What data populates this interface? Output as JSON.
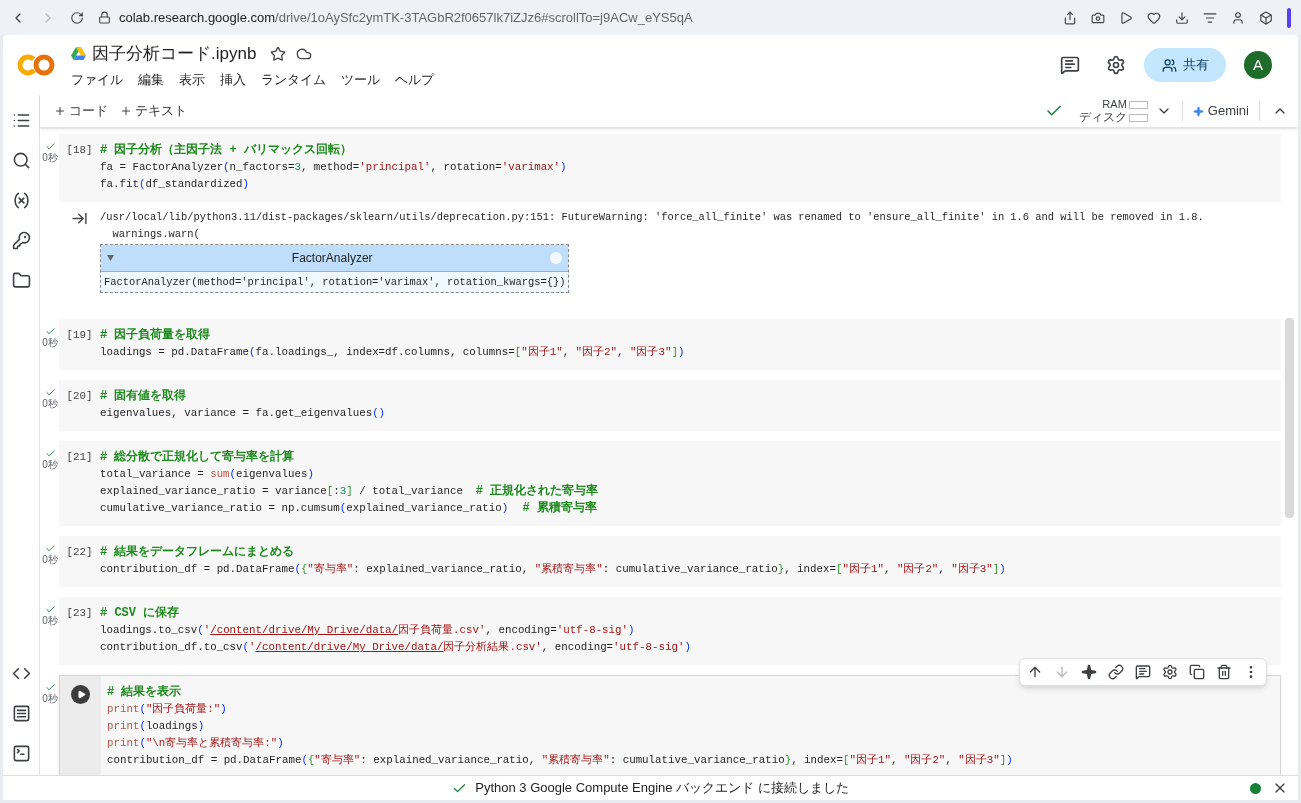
{
  "browser": {
    "url_host": "colab.research.google.com",
    "url_path": "/drive/1oAySfc2ymTK-3TAGbR2f0657lk7iZJz6#scrollTo=j9ACw_eYS5qA"
  },
  "header": {
    "title": "因子分析コード.ipynb",
    "menu": [
      "ファイル",
      "編集",
      "表示",
      "挿入",
      "ランタイム",
      "ツール",
      "ヘルプ"
    ],
    "share": "共有",
    "avatar": "A"
  },
  "toolbar": {
    "add_code": "コード",
    "add_text": "テキスト",
    "connected": true,
    "ram": "RAM",
    "disk": "ディスク",
    "gemini": "Gemini"
  },
  "cells": [
    {
      "count": "[18]",
      "status": "0秒",
      "executed": true,
      "selected": false,
      "lines": [
        [
          {
            "kind": "comment",
            "text": "# 因子分析（主因子法 + バリマックス回転）"
          }
        ],
        [
          {
            "kind": "text",
            "text": "fa = FactorAnalyzer"
          },
          {
            "kind": "paren",
            "text": "("
          },
          {
            "kind": "text",
            "text": "n_factors="
          },
          {
            "kind": "number",
            "text": "3"
          },
          {
            "kind": "text",
            "text": ", method="
          },
          {
            "kind": "string",
            "text": "'principal'"
          },
          {
            "kind": "text",
            "text": ", rotation="
          },
          {
            "kind": "string",
            "text": "'varimax'"
          },
          {
            "kind": "paren",
            "text": ")"
          }
        ],
        [
          {
            "kind": "text",
            "text": "fa.fit"
          },
          {
            "kind": "paren",
            "text": "("
          },
          {
            "kind": "text",
            "text": "df_standardized"
          },
          {
            "kind": "paren",
            "text": ")"
          }
        ]
      ],
      "output": {
        "lines": [
          "/usr/local/lib/python3.11/dist-packages/sklearn/utils/deprecation.py:151: FutureWarning: 'force_all_finite' was renamed to 'ensure_all_finite' in 1.6 and will be removed in 1.8.",
          "  warnings.warn("
        ],
        "widget": {
          "title": "FactorAnalyzer",
          "expanded": true,
          "body": "FactorAnalyzer(method='principal', rotation='varimax', rotation_kwargs={})"
        }
      }
    },
    {
      "count": "[19]",
      "status": "0秒",
      "executed": true,
      "selected": false,
      "lines": [
        [
          {
            "kind": "comment",
            "text": "# 因子負荷量を取得"
          }
        ],
        [
          {
            "kind": "text",
            "text": "loadings = pd.DataFrame"
          },
          {
            "kind": "paren",
            "text": "("
          },
          {
            "kind": "text",
            "text": "fa.loadings_, index=df.columns, columns="
          },
          {
            "kind": "bracket",
            "text": "["
          },
          {
            "kind": "string",
            "text": "\"因子1\""
          },
          {
            "kind": "text",
            "text": ", "
          },
          {
            "kind": "string",
            "text": "\"因子2\""
          },
          {
            "kind": "text",
            "text": ", "
          },
          {
            "kind": "string",
            "text": "\"因子3\""
          },
          {
            "kind": "bracket",
            "text": "]"
          },
          {
            "kind": "paren",
            "text": ")"
          }
        ]
      ]
    },
    {
      "count": "[20]",
      "status": "0秒",
      "executed": true,
      "selected": false,
      "lines": [
        [
          {
            "kind": "comment",
            "text": "# 固有値を取得"
          }
        ],
        [
          {
            "kind": "text",
            "text": "eigenvalues, variance = fa.get_eigenvalues"
          },
          {
            "kind": "paren",
            "text": "()"
          }
        ]
      ]
    },
    {
      "count": "[21]",
      "status": "0秒",
      "executed": true,
      "selected": false,
      "lines": [
        [
          {
            "kind": "comment",
            "text": "# 総分散で正規化して寄与率を計算"
          }
        ],
        [
          {
            "kind": "text",
            "text": "total_variance = "
          },
          {
            "kind": "builtin",
            "text": "sum"
          },
          {
            "kind": "paren",
            "text": "("
          },
          {
            "kind": "text",
            "text": "eigenvalues"
          },
          {
            "kind": "paren",
            "text": ")"
          }
        ],
        [
          {
            "kind": "text",
            "text": "explained_variance_ratio = variance"
          },
          {
            "kind": "bracket",
            "text": "["
          },
          {
            "kind": "text",
            "text": ":"
          },
          {
            "kind": "number",
            "text": "3"
          },
          {
            "kind": "bracket",
            "text": "]"
          },
          {
            "kind": "text",
            "text": " / total_variance  "
          },
          {
            "kind": "comment",
            "text": "# 正規化された寄与率"
          }
        ],
        [
          {
            "kind": "text",
            "text": "cumulative_variance_ratio = np.cumsum"
          },
          {
            "kind": "paren",
            "text": "("
          },
          {
            "kind": "text",
            "text": "explained_variance_ratio"
          },
          {
            "kind": "paren",
            "text": ")"
          },
          {
            "kind": "comment",
            "text": "  # 累積寄与率"
          }
        ]
      ]
    },
    {
      "count": "[22]",
      "status": "0秒",
      "executed": true,
      "selected": false,
      "lines": [
        [
          {
            "kind": "comment",
            "text": "# 結果をデータフレームにまとめる"
          }
        ],
        [
          {
            "kind": "text",
            "text": "contribution_df = pd.DataFrame"
          },
          {
            "kind": "paren",
            "text": "("
          },
          {
            "kind": "bracket",
            "text": "{"
          },
          {
            "kind": "string",
            "text": "\"寄与率\""
          },
          {
            "kind": "text",
            "text": ": explained_variance_ratio, "
          },
          {
            "kind": "string",
            "text": "\"累積寄与率\""
          },
          {
            "kind": "text",
            "text": ": cumulative_variance_ratio"
          },
          {
            "kind": "bracket",
            "text": "}"
          },
          {
            "kind": "text",
            "text": ", index="
          },
          {
            "kind": "bracket",
            "text": "["
          },
          {
            "kind": "string",
            "text": "\"因子1\""
          },
          {
            "kind": "text",
            "text": ", "
          },
          {
            "kind": "string",
            "text": "\"因子2\""
          },
          {
            "kind": "text",
            "text": ", "
          },
          {
            "kind": "string",
            "text": "\"因子3\""
          },
          {
            "kind": "bracket",
            "text": "]"
          },
          {
            "kind": "paren",
            "text": ")"
          }
        ]
      ]
    },
    {
      "count": "[23]",
      "status": "0秒",
      "executed": true,
      "selected": false,
      "lines": [
        [
          {
            "kind": "comment",
            "text": "# CSV に保存"
          }
        ],
        [
          {
            "kind": "text",
            "text": "loadings.to_csv"
          },
          {
            "kind": "paren",
            "text": "("
          },
          {
            "kind": "string",
            "text": "'"
          },
          {
            "kind": "link",
            "text": "/content/drive/My Drive/data/"
          },
          {
            "kind": "string",
            "text": "因子負荷量.csv'"
          },
          {
            "kind": "text",
            "text": ", encoding="
          },
          {
            "kind": "string",
            "text": "'utf-8-sig'"
          },
          {
            "kind": "paren",
            "text": ")"
          }
        ],
        [
          {
            "kind": "text",
            "text": "contribution_df.to_csv"
          },
          {
            "kind": "paren",
            "text": "("
          },
          {
            "kind": "string",
            "text": "'"
          },
          {
            "kind": "link",
            "text": "/content/drive/My Drive/data/"
          },
          {
            "kind": "string",
            "text": "因子分析結果.csv'"
          },
          {
            "kind": "text",
            "text": ", encoding="
          },
          {
            "kind": "string",
            "text": "'utf-8-sig'"
          },
          {
            "kind": "paren",
            "text": ")"
          }
        ]
      ]
    },
    {
      "status": "0秒",
      "executed": true,
      "selected": true,
      "lines": [
        [
          {
            "kind": "comment",
            "text": "# 結果を表示"
          }
        ],
        [
          {
            "kind": "builtin",
            "text": "print"
          },
          {
            "kind": "paren",
            "text": "("
          },
          {
            "kind": "string",
            "text": "\"因子負荷量:\""
          },
          {
            "kind": "paren",
            "text": ")"
          }
        ],
        [
          {
            "kind": "builtin",
            "text": "print"
          },
          {
            "kind": "paren",
            "text": "("
          },
          {
            "kind": "text",
            "text": "loadings"
          },
          {
            "kind": "paren",
            "text": ")"
          }
        ],
        [
          {
            "kind": "builtin",
            "text": "print"
          },
          {
            "kind": "paren",
            "text": "("
          },
          {
            "kind": "string",
            "text": "\"\\n寄与率と累積寄与率:\""
          },
          {
            "kind": "paren",
            "text": ")"
          }
        ],
        [
          {
            "kind": "text",
            "text": "contribution_df = pd.DataFrame"
          },
          {
            "kind": "paren",
            "text": "("
          },
          {
            "kind": "bracket",
            "text": "{"
          },
          {
            "kind": "string",
            "text": "\"寄与率\""
          },
          {
            "kind": "text",
            "text": ": explained_variance_ratio, "
          },
          {
            "kind": "string",
            "text": "\"累積寄与率\""
          },
          {
            "kind": "text",
            "text": ": cumulative_variance_ratio"
          },
          {
            "kind": "bracket",
            "text": "}"
          },
          {
            "kind": "text",
            "text": ", index="
          },
          {
            "kind": "bracket",
            "text": "["
          },
          {
            "kind": "string",
            "text": "\"因子1\""
          },
          {
            "kind": "text",
            "text": ", "
          },
          {
            "kind": "string",
            "text": "\"因子2\""
          },
          {
            "kind": "text",
            "text": ", "
          },
          {
            "kind": "string",
            "text": "\"因子3\""
          },
          {
            "kind": "bracket",
            "text": "]"
          },
          {
            "kind": "paren",
            "text": ")"
          }
        ]
      ]
    }
  ],
  "status_bar": {
    "connected": true,
    "message": "Python 3 Google Compute Engine バックエンド に接続しました"
  }
}
